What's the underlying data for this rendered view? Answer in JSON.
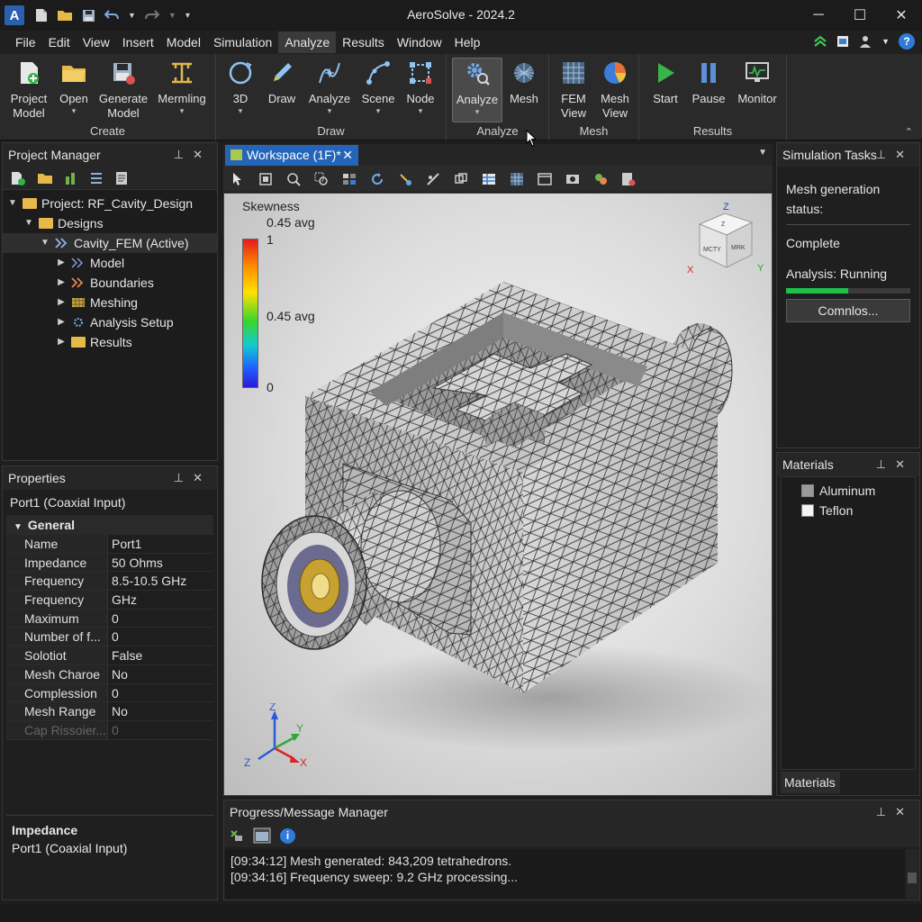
{
  "app": {
    "icon_letter": "A",
    "title": "AeroSolve - 2024.2"
  },
  "quick_access": {
    "icons": [
      "new-file-icon",
      "open-folder-icon",
      "save-icon",
      "undo-icon",
      "redo-icon",
      "customize-icon"
    ]
  },
  "window_controls": {
    "minimize": "─",
    "maximize": "☐",
    "close": "✕"
  },
  "menu": {
    "items": [
      "File",
      "Edit",
      "View",
      "Insert",
      "Model",
      "Simulation",
      "Analyze",
      "Results",
      "Window",
      "Help"
    ],
    "active": "Analyze",
    "help_glyph": "?"
  },
  "ribbon": {
    "groups": [
      {
        "label": "Create",
        "buttons": [
          {
            "label": "Project Model",
            "icon": "project-model-icon",
            "caret": false
          },
          {
            "label": "Open",
            "icon": "open-folder-icon",
            "caret": true
          },
          {
            "label": "Generate Model",
            "icon": "generate-model-icon",
            "caret": false
          },
          {
            "label": "Mermling",
            "icon": "mermling-icon",
            "caret": true
          }
        ]
      },
      {
        "label": "Draw",
        "buttons": [
          {
            "label": "3D",
            "icon": "rotate-3d-icon",
            "caret": true
          },
          {
            "label": "Draw",
            "icon": "pencil-icon",
            "caret": false
          },
          {
            "label": "Analyze",
            "icon": "analyze-curve-icon",
            "caret": true
          },
          {
            "label": "Scene",
            "icon": "scene-icon",
            "caret": true
          },
          {
            "label": "Node",
            "icon": "node-icon",
            "caret": true
          }
        ]
      },
      {
        "label": "Analyze",
        "buttons": [
          {
            "label": "Analyze",
            "icon": "analyze-gear-icon",
            "caret": true,
            "selected": true
          },
          {
            "label": "Mesh",
            "icon": "mesh-sphere-icon",
            "caret": false
          }
        ]
      },
      {
        "label": "Mesh",
        "buttons": [
          {
            "label": "FEM View",
            "icon": "fem-view-icon",
            "caret": false
          },
          {
            "label": "Mesh View",
            "icon": "pie-chart-icon",
            "caret": false
          }
        ]
      },
      {
        "label": "Results",
        "buttons": [
          {
            "label": "Start",
            "icon": "play-icon",
            "caret": false
          },
          {
            "label": "Pause",
            "icon": "pause-icon",
            "caret": false
          },
          {
            "label": "Monitor",
            "icon": "monitor-icon",
            "caret": false
          }
        ]
      }
    ]
  },
  "project_manager": {
    "title": "Project Manager",
    "tree": [
      {
        "label": "Project: RF_Cavity_Design",
        "level": 0,
        "expanded": true,
        "icon": "folder-icon"
      },
      {
        "label": "Designs",
        "level": 1,
        "expanded": true,
        "icon": "folder-icon"
      },
      {
        "label": "Cavity_FEM (Active)",
        "level": 2,
        "expanded": true,
        "icon": "design-icon",
        "active": true
      },
      {
        "label": "Model",
        "level": 3,
        "expanded": false,
        "icon": "model-icon"
      },
      {
        "label": "Boundaries",
        "level": 3,
        "expanded": false,
        "icon": "boundaries-icon"
      },
      {
        "label": "Meshing",
        "level": 3,
        "expanded": false,
        "icon": "meshing-icon"
      },
      {
        "label": "Analysis Setup",
        "level": 3,
        "expanded": false,
        "icon": "analysis-setup-icon"
      },
      {
        "label": "Results",
        "level": 3,
        "expanded": false,
        "icon": "folder-icon"
      }
    ]
  },
  "properties": {
    "title": "Properties",
    "object": "Port1 (Coaxial Input)",
    "group": "General",
    "rows": [
      {
        "k": "Name",
        "v": "Port1"
      },
      {
        "k": "Impedance",
        "v": "50 Ohms"
      },
      {
        "k": "Frequency",
        "v": "8.5-10.5 GHz"
      },
      {
        "k": "Frequency",
        "v": "GHz"
      },
      {
        "k": "Maximum",
        "v": "0"
      },
      {
        "k": "Number of f...",
        "v": "0"
      },
      {
        "k": "Solotiot",
        "v": "False"
      },
      {
        "k": "Mesh Charoe",
        "v": "No"
      },
      {
        "k": "Complession",
        "v": "0"
      },
      {
        "k": "Mesh Range",
        "v": "No"
      },
      {
        "k": "Cap Rissoier...",
        "v": "0",
        "dim": true
      }
    ],
    "description_title": "Impedance",
    "description_text": "Port1 (Coaxial Input)"
  },
  "workspace": {
    "tab_label": "Workspace (1F)*",
    "tab_close": "✕",
    "legend": {
      "title": "Skewness",
      "avg": "0.45 avg",
      "max": "1",
      "mid": "0.45 avg",
      "min": "0"
    },
    "view_cube": {
      "top": "Z",
      "front": "MCTY",
      "side": "MRK",
      "axis_z": "Z",
      "axis_x": "X",
      "axis_y": "Y"
    },
    "triad": {
      "z": "Z",
      "y": "Y",
      "x": "X",
      "z2": "Z"
    }
  },
  "simulation_tasks": {
    "title": "Simulation Tasks",
    "status_label": "Mesh generation status:",
    "status_value": "Complete",
    "analysis_label": "Analysis: Running",
    "progress": 0.5,
    "button_label": "Comnlos..."
  },
  "materials": {
    "title": "Materials",
    "items": [
      {
        "name": "Aluminum",
        "color": "#9a9a9a"
      },
      {
        "name": "Teflon",
        "color": "#f4f4f4"
      }
    ],
    "tab_label": "Materials"
  },
  "messages": {
    "title": "Progress/Message Manager",
    "lines": [
      "[09:34:12] Mesh generated: 843,209 tetrahedrons.",
      "[09:34:16] Frequency sweep: 9.2 GHz processing..."
    ]
  },
  "colors": {
    "accent": "#2565b9",
    "progress": "#1ec24b",
    "active_tab": "#2565b9"
  }
}
